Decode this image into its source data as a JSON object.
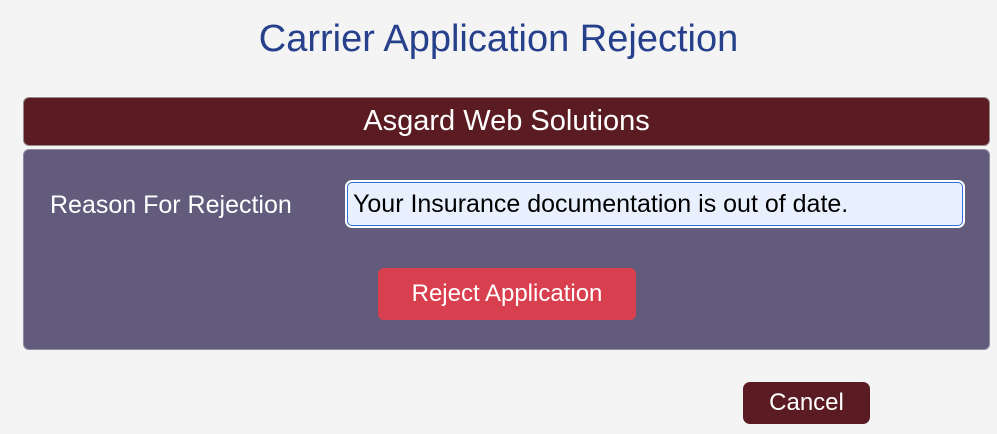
{
  "page": {
    "title": "Carrier Application Rejection"
  },
  "panel": {
    "company_name": "Asgard Web Solutions",
    "reason_label": "Reason For Rejection",
    "reason_value": "Your Insurance documentation is out of date.",
    "reject_label": "Reject Application"
  },
  "footer": {
    "cancel_label": "Cancel"
  },
  "colors": {
    "title": "#26408b",
    "header_bg": "#5a1c22",
    "panel_bg": "#625b7c",
    "reject_button": "#d9404f",
    "cancel_button": "#5a1c22",
    "input_bg": "#e8f0fe"
  }
}
